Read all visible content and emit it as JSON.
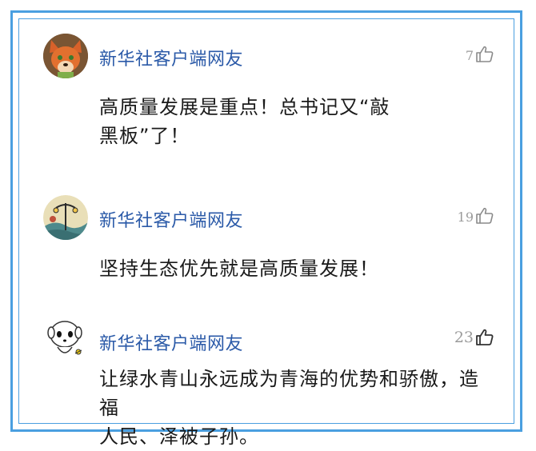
{
  "comments": [
    {
      "username": "新华社客户端网友",
      "likes": "7",
      "text_line1": "高质量发展是重点！总书记又“敲",
      "text_line2": "黑板”了！",
      "avatar_icon": "fox-avatar-icon"
    },
    {
      "username": "新华社客户端网友",
      "likes": "19",
      "text_line1": "坚持生态优先就是高质量发展！",
      "avatar_icon": "street-lamp-avatar-icon"
    },
    {
      "username": "新华社客户端网友",
      "likes": "23",
      "text_line1": "让绿水青山永远成为青海的优势和骄傲，造福",
      "text_line2": "人民、泽被子孙。",
      "avatar_icon": "cartoon-dog-avatar-icon"
    }
  ],
  "colors": {
    "frame": "#4a9fe0",
    "username": "#2b5aa8",
    "like_count": "#9a9a9a",
    "text": "#1a1a1a"
  }
}
